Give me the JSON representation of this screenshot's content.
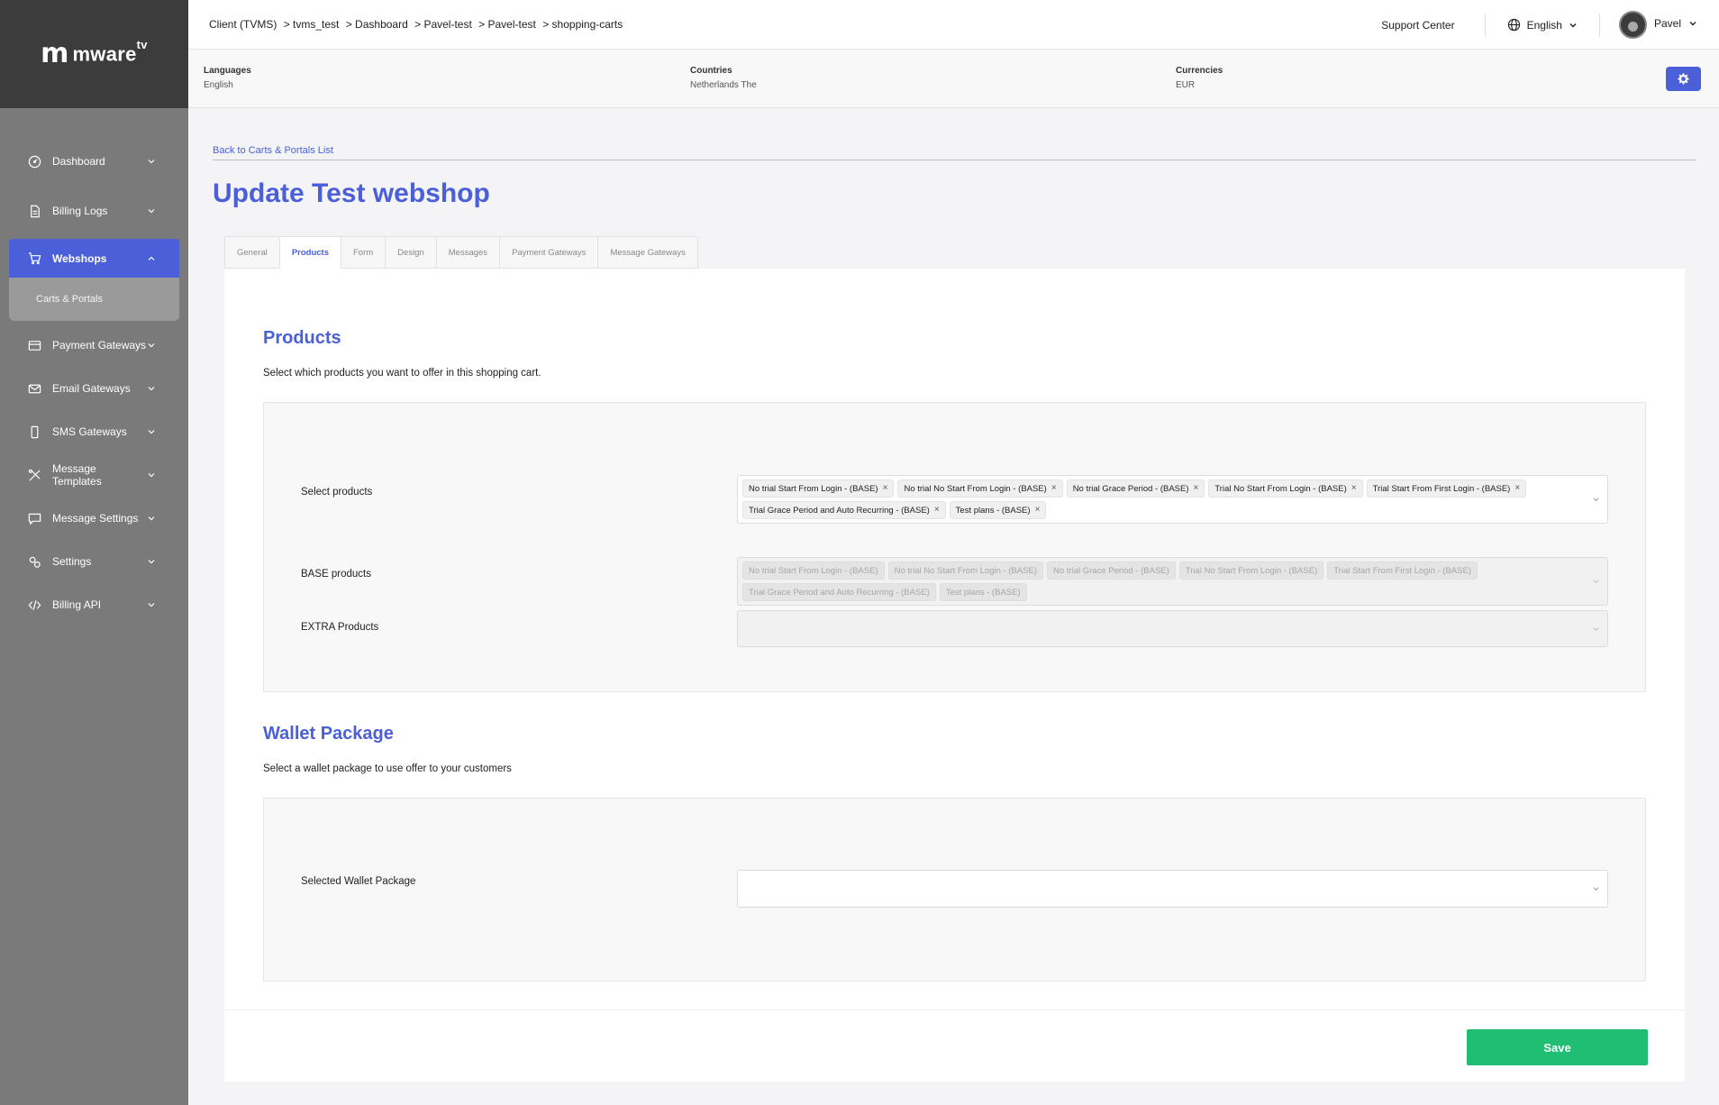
{
  "brand": {
    "name": "mware",
    "suffix": "tv"
  },
  "sidebar": {
    "items": [
      {
        "label": "Dashboard",
        "icon": "gauge-icon"
      },
      {
        "label": "Billing Logs",
        "icon": "document-icon"
      },
      {
        "label": "Webshops",
        "icon": "cart-icon",
        "active": true
      },
      {
        "label": "Payment Gateways",
        "icon": "credit-card-icon"
      },
      {
        "label": "Email Gateways",
        "icon": "mail-icon"
      },
      {
        "label": "SMS Gateways",
        "icon": "phone-icon"
      },
      {
        "label": "Message Templates",
        "icon": "brush-icon"
      },
      {
        "label": "Message Settings",
        "icon": "chat-icon"
      },
      {
        "label": "Settings",
        "icon": "cogs-icon"
      },
      {
        "label": "Billing API",
        "icon": "code-icon"
      }
    ],
    "subitem": "Carts & Portals"
  },
  "topbar": {
    "breadcrumbs": [
      "Client (TVMS)",
      "> tvms_test",
      "> Dashboard",
      "> Pavel-test",
      "> Pavel-test",
      "> shopping-carts"
    ],
    "support": "Support Center",
    "language": "English",
    "user": "Pavel"
  },
  "infobar": {
    "languages": {
      "label": "Languages",
      "value": "English"
    },
    "countries": {
      "label": "Countries",
      "value": "Netherlands The"
    },
    "currencies": {
      "label": "Currencies",
      "value": "EUR"
    }
  },
  "main": {
    "back_link": "Back to Carts & Portals List",
    "title": "Update Test webshop",
    "tabs": [
      "General",
      "Products",
      "Form",
      "Design",
      "Messages",
      "Payment Gateways",
      "Message Gateways"
    ],
    "active_tab": "Products",
    "products": {
      "title": "Products",
      "description": "Select which products you want to offer in this shopping cart.",
      "select_label": "Select products",
      "selected": [
        "No trial Start From Login - (BASE)",
        "No trial No Start From Login - (BASE)",
        "No trial Grace Period - (BASE)",
        "Trial No Start From Login - (BASE)",
        "Trial Start From First Login - (BASE)",
        "Trial Grace Period and Auto Recurring - (BASE)",
        "Test plans - (BASE)"
      ],
      "base_label": "BASE products",
      "base": [
        "No trial Start From Login - (BASE)",
        "No trial No Start From Login - (BASE)",
        "No trial Grace Period - (BASE)",
        "Trial No Start From Login - (BASE)",
        "Trial Start From First Login - (BASE)",
        "Trial Grace Period and Auto Recurring - (BASE)",
        "Test plans - (BASE)"
      ],
      "extra_label": "EXTRA Products"
    },
    "wallet": {
      "title": "Wallet Package",
      "description": "Select a wallet package to use offer to your customers",
      "select_label": "Selected Wallet Package"
    },
    "save": "Save"
  },
  "colors": {
    "accent": "#4a5fd8",
    "save": "#1fbe72",
    "sidebar": "#7a7a7a",
    "logo_bg": "#3c3c3c"
  }
}
